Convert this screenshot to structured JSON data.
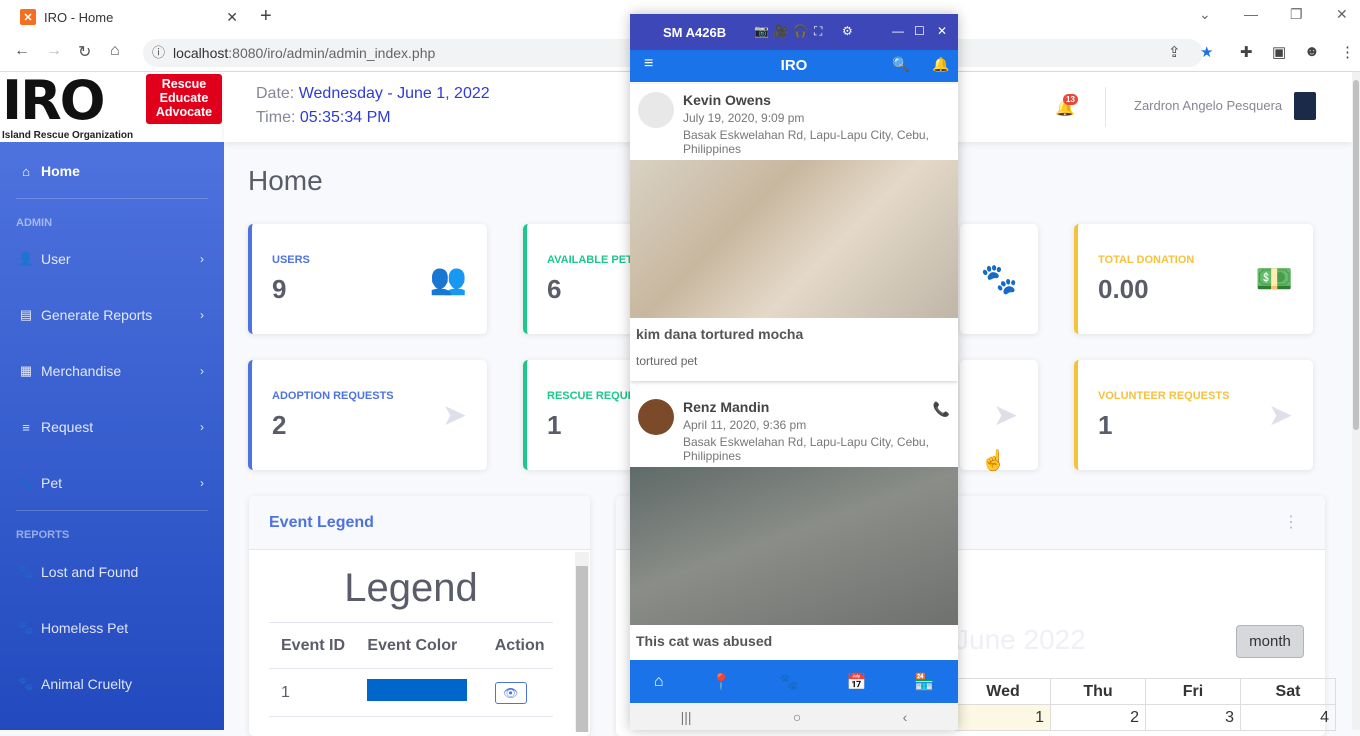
{
  "browser": {
    "tab_title": "IRO - Home",
    "url_host": "localhost",
    "url_rest": ":8080/iro/admin/admin_index.php"
  },
  "brand": {
    "logo": "IRO",
    "org_name": "Island Rescue Organization",
    "badge_lines": [
      "Rescue",
      "Educate",
      "Advocate"
    ]
  },
  "sidebar": {
    "home": "Home",
    "admin_heading": "ADMIN",
    "admin_items": [
      {
        "label": "User",
        "icon": "user-icon"
      },
      {
        "label": "Generate Reports",
        "icon": "file-icon"
      },
      {
        "label": "Merchandise",
        "icon": "store-icon"
      },
      {
        "label": "Request",
        "icon": "list-icon"
      },
      {
        "label": "Pet",
        "icon": "paw-icon"
      }
    ],
    "reports_heading": "REPORTS",
    "report_items": [
      {
        "label": "Lost and Found",
        "icon": "paw-icon"
      },
      {
        "label": "Homeless Pet",
        "icon": "paw-icon"
      },
      {
        "label": "Animal Cruelty",
        "icon": "paw-icon"
      }
    ]
  },
  "topbar": {
    "date_label": "Date:",
    "date_value": "Wednesday - June 1, 2022",
    "time_label": "Time:",
    "time_value": "05:35:34 PM",
    "notif_count": "13",
    "user_name": "Zardron Angelo Pesquera"
  },
  "main": {
    "title": "Home",
    "cards": [
      {
        "label": "USERS",
        "value": "9"
      },
      {
        "label": "AVAILABLE PET",
        "value": "6"
      },
      {
        "label": "TOTAL DONATION",
        "value": "0.00"
      },
      {
        "label": "ADOPTION REQUESTS",
        "value": "2"
      },
      {
        "label": "RESCUE REQUE",
        "value": "1"
      },
      {
        "label": "VOLUNTEER REQUESTS",
        "value": "1"
      }
    ],
    "legend_panel": {
      "title": "Event Legend",
      "heading": "Legend",
      "columns": [
        "Event ID",
        "Event Color",
        "Action"
      ],
      "rows": [
        {
          "id": "1",
          "color": "#0066cc"
        }
      ]
    },
    "calendar": {
      "month_title": "June 2022",
      "month_btn": "month",
      "days": [
        "Wed",
        "Thu",
        "Fri",
        "Sat"
      ],
      "dates": [
        "1",
        "2",
        "3",
        "4"
      ]
    }
  },
  "phone": {
    "device": "SM A426B",
    "app_title": "IRO",
    "posts": [
      {
        "name": "Kevin Owens",
        "date": "July 19, 2020, 9:09 pm",
        "address": "Basak Eskwelahan Rd, Lapu-Lapu City, Cebu, Philippines",
        "title": "kim dana tortured mocha",
        "desc": "tortured pet"
      },
      {
        "name": "Renz Mandin",
        "date": "April 11, 2020, 9:36 pm",
        "address": "Basak Eskwelahan Rd, Lapu-Lapu City, Cebu, Philippines",
        "title": "This cat was abused"
      }
    ]
  },
  "colors": {
    "primary": "#4e73df",
    "success": "#1cc88a",
    "warning": "#f6c23e",
    "app_blue": "#1a73e8"
  }
}
